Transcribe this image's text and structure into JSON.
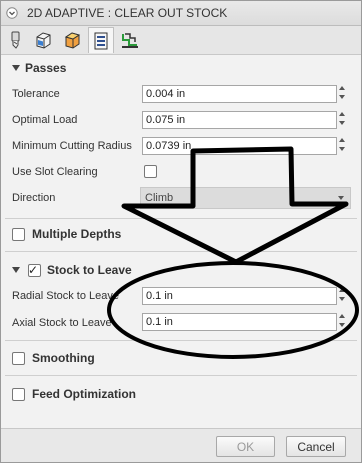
{
  "window": {
    "title": "2D ADAPTIVE : CLEAR OUT STOCK"
  },
  "tabs": [
    {
      "icon": "tool-icon"
    },
    {
      "icon": "geometry-icon"
    },
    {
      "icon": "heights-icon"
    },
    {
      "icon": "passes-icon",
      "active": true
    },
    {
      "icon": "linking-icon"
    }
  ],
  "passes": {
    "header": "Passes",
    "tolerance": {
      "label": "Tolerance",
      "value": "0.004 in"
    },
    "optimal_load": {
      "label": "Optimal Load",
      "value": "0.075 in"
    },
    "min_cutting_radius": {
      "label": "Minimum Cutting Radius",
      "value": "0.0739 in"
    },
    "use_slot_clearing": {
      "label": "Use Slot Clearing",
      "checked": false
    },
    "direction": {
      "label": "Direction",
      "value": "Climb"
    }
  },
  "multiple_depths": {
    "label": "Multiple Depths",
    "checked": false
  },
  "stock_to_leave": {
    "header": "Stock to Leave",
    "checked": true,
    "radial": {
      "label": "Radial Stock to Leave",
      "value": "0.1 in"
    },
    "axial": {
      "label": "Axial Stock to Leave",
      "value": "0.1 in"
    }
  },
  "smoothing": {
    "label": "Smoothing",
    "checked": false
  },
  "feed_optimization": {
    "label": "Feed Optimization",
    "checked": false
  },
  "buttons": {
    "ok": "OK",
    "cancel": "Cancel"
  }
}
